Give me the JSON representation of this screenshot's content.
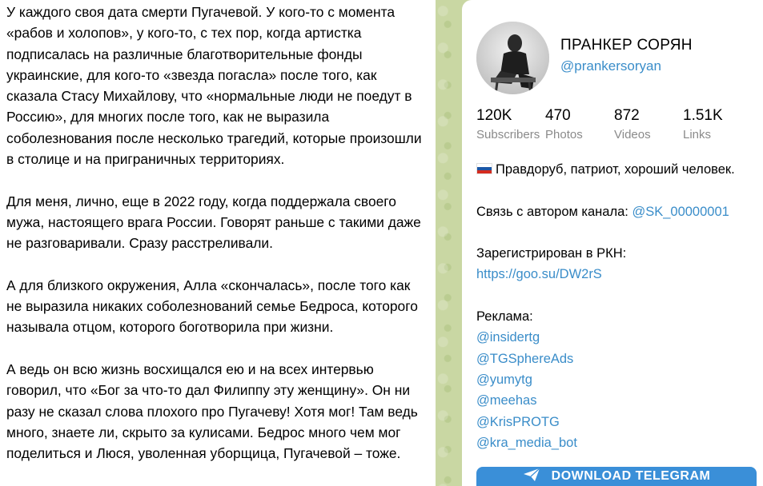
{
  "post": {
    "paragraphs": [
      "У каждого своя дата смерти Пугачевой. У кого-то с момента «рабов и холопов», у кого-то, с тех пор, когда артистка подписалась на различные благотворительные фонды украинские, для кого-то «звезда погасла» после того, как сказала Стасу Михайлову, что «нормальные люди не поедут в Россию», для многих после того, как не выразила соболезнования после несколько трагедий, которые произошли в столице и на приграничных территориях.",
      "Для меня, лично, еще в 2022 году, когда поддержала своего мужа, настоящего врага России. Говорят раньше с такими даже не разговаривали. Сразу расстреливали.",
      "А для близкого окружения, Алла «скончалась», после того как не выразила никаких соболезнований семье Бедроса, которого называла отцом, которого боготворила при жизни.",
      "А ведь он всю жизнь восхищался ею и на всех интервью говорил, что «Бог за что-то дал Филиппу эту женщину». Он ни разу не сказал слова плохого про Пугачеву! Хотя мог! Там ведь много, знаете ли, скрыто за кулисами. Бедрос много чем мог поделиться и Люся, уволенная уборщица, Пугачевой – тоже."
    ]
  },
  "channel": {
    "name": "ПРАНКЕР СОРЯН",
    "handle": "@prankersoryan",
    "stats": [
      {
        "value": "120K",
        "label": "Subscribers"
      },
      {
        "value": "470",
        "label": "Photos"
      },
      {
        "value": "872",
        "label": "Videos"
      },
      {
        "value": "1.51K",
        "label": "Links"
      }
    ],
    "description": {
      "tagline": "Правдоруб, патриот, хороший человек.",
      "contact_label": "Связь с автором канала: ",
      "contact_link": "@SK_00000001",
      "rkn_label": "Зарегистрирован в РКН:",
      "rkn_link": "https://goo.su/DW2rS",
      "ads_label": "Реклама:",
      "ads_links": [
        "@insidertg",
        "@TGSphereAds",
        "@yumytg",
        "@meehas",
        "@KrisPROTG",
        "@kra_media_bot"
      ]
    },
    "download_button": "DOWNLOAD TELEGRAM"
  },
  "colors": {
    "link": "#3a8dc9",
    "button": "#3a8fd8",
    "panel_bg": "#c9d7a3",
    "muted": "#8a8a8a"
  },
  "icons": [
    "avatar-photo",
    "russia-flag-icon",
    "paper-plane-icon"
  ]
}
